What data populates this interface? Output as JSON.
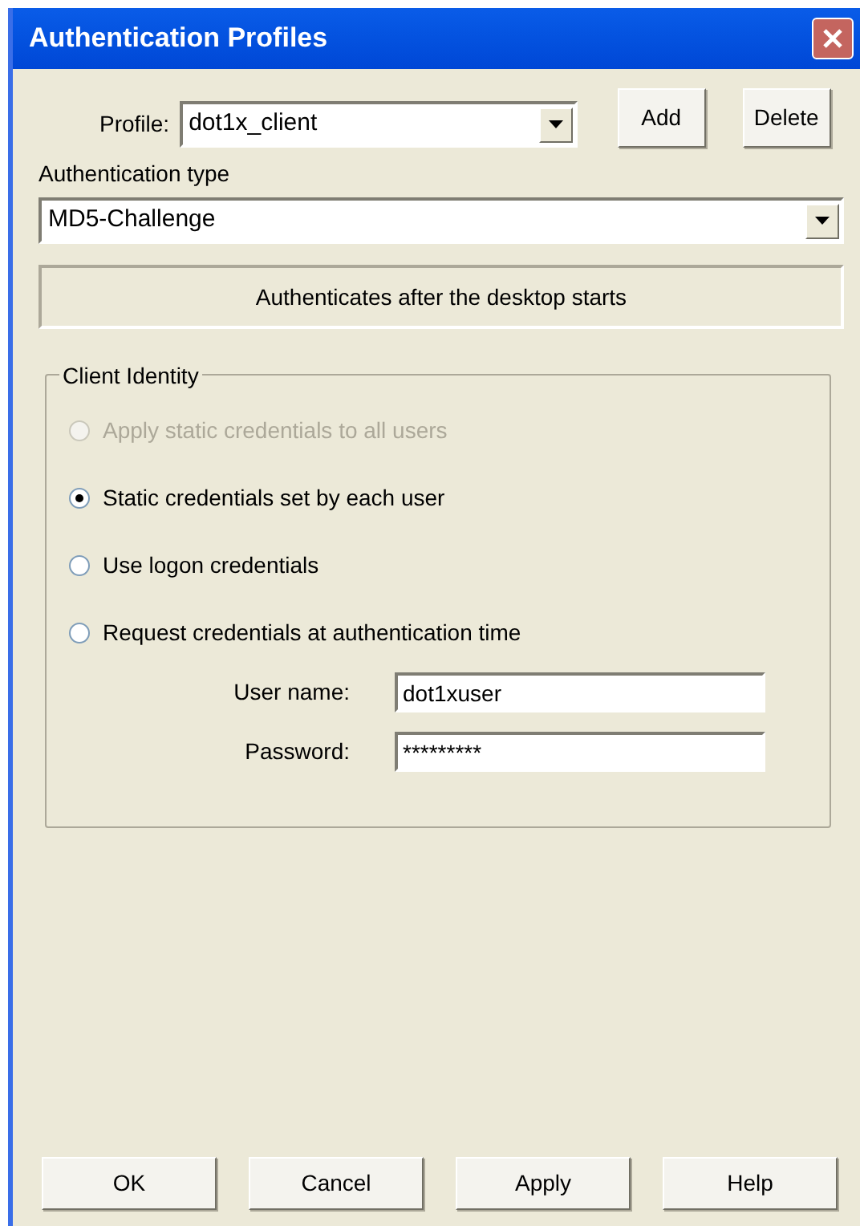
{
  "window": {
    "title": "Authentication Profiles"
  },
  "profile": {
    "label": "Profile:",
    "value": "dot1x_client"
  },
  "profile_buttons": [
    "Add",
    "Delete"
  ],
  "auth_type": {
    "label": "Authentication type",
    "value": "MD5-Challenge"
  },
  "info": "Authenticates after the desktop starts",
  "client_identity": {
    "title": "Client Identity",
    "options": [
      {
        "label": "Apply static credentials to all users",
        "selected": false,
        "disabled": true
      },
      {
        "label": "Static credentials set by each user",
        "selected": true,
        "disabled": false
      },
      {
        "label": "Use logon credentials",
        "selected": false,
        "disabled": false
      },
      {
        "label": "Request credentials at authentication time",
        "selected": false,
        "disabled": false
      }
    ],
    "fields": [
      {
        "label": "User name:",
        "value": "dot1xuser"
      },
      {
        "label": "Password:",
        "value": "*********"
      }
    ]
  },
  "buttons": [
    "OK",
    "Cancel",
    "Apply",
    "Help"
  ]
}
